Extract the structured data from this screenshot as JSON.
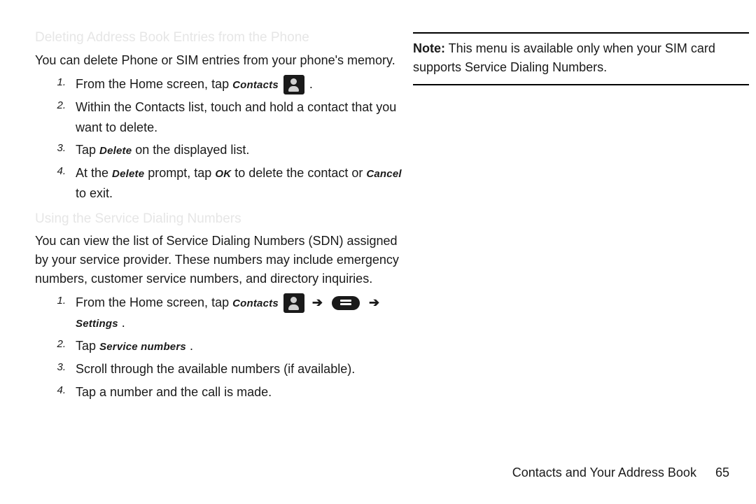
{
  "section1": {
    "title": "Deleting Address Book Entries from the Phone",
    "intro": "You can delete Phone or SIM entries from your phone's memory.",
    "steps": {
      "s1a": "From the Home screen, tap ",
      "s1b": "Contacts",
      "s1c": " .",
      "s2": "Within the Contacts list, touch and hold a contact that you want to delete.",
      "s3a": "Tap ",
      "s3b": "Delete",
      "s3c": " on the displayed list.",
      "s4a": "At the ",
      "s4b": "Delete",
      "s4c": " prompt, tap ",
      "s4d": "OK",
      "s4e": " to delete the contact or ",
      "s4f": "Cancel",
      "s4g": " to exit."
    }
  },
  "section2": {
    "title": "Using the Service Dialing Numbers",
    "intro": "You can view the list of Service Dialing Numbers (SDN) assigned by your service provider. These numbers may include emergency numbers, customer service numbers, and directory inquiries.",
    "steps": {
      "s1a": "From the Home screen, tap ",
      "s1b": "Contacts",
      "s1arrow": "➔",
      "s1settings": "Settings",
      "s1c": " .",
      "s2a": "Tap ",
      "s2b": "Service numbers",
      "s2c": " .",
      "s3": "Scroll through the available numbers (if available).",
      "s4": "Tap a number and the call is made."
    }
  },
  "note": {
    "label": "Note:",
    "text": " This menu is available only when your SIM card supports Service Dialing Numbers."
  },
  "footer": {
    "chapter": "Contacts and Your Address Book",
    "page": "65"
  },
  "nums": {
    "n1": "1.",
    "n2": "2.",
    "n3": "3.",
    "n4": "4."
  }
}
